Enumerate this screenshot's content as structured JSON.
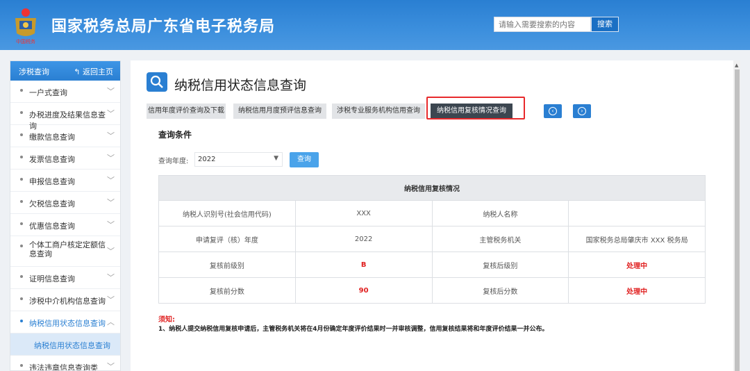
{
  "header": {
    "site_title": "国家税务总局广东省电子税务局",
    "search_placeholder": "请输入需要搜索的内容",
    "search_button": "搜索"
  },
  "sidebar": {
    "title": "涉税查询",
    "back_label": "返回主页",
    "items": [
      {
        "label": "一户式查询"
      },
      {
        "label": "办税进度及结果信息查询"
      },
      {
        "label": "缴款信息查询"
      },
      {
        "label": "发票信息查询"
      },
      {
        "label": "申报信息查询"
      },
      {
        "label": "欠税信息查询"
      },
      {
        "label": "优惠信息查询"
      },
      {
        "label": "个体工商户核定定额信息查询"
      },
      {
        "label": "证明信息查询"
      },
      {
        "label": "涉税中介机构信息查询"
      },
      {
        "label": "纳税信用状态信息查询"
      },
      {
        "label": "违法违章信息查询类"
      }
    ],
    "active_sub": "纳税信用状态信息查询"
  },
  "page": {
    "title": "纳税信用状态信息查询",
    "tabs": [
      "信用年度评价查询及下载",
      "纳税信用月度预评信息查询",
      "涉税专业服务机构信用查询",
      "纳税信用复核情况查询"
    ],
    "active_tab_index": 3
  },
  "query": {
    "section_title": "查询条件",
    "year_label": "查询年度:",
    "year_value": "2022",
    "button": "查询"
  },
  "table": {
    "header": "纳税信用复核情况",
    "rows": [
      [
        "纳税人识别号(社会信用代码)",
        "XXX",
        "纳税人名称",
        ""
      ],
      [
        "申请复评（核）年度",
        "2022",
        "主管税务机关",
        "国家税务总局肇庆市 XXX 税务局"
      ],
      [
        "复核前级别",
        "B",
        "复核后级别",
        "处理中"
      ],
      [
        "复核前分数",
        "90",
        "复核后分数",
        "处理中"
      ]
    ]
  },
  "notice": {
    "title": "须知:",
    "text": "1、纳税人提交纳税信用复核申请后，主管税务机关将在4月份确定年度评价结果时一并审核调整，信用复核结果将和年度评价结果一并公布。"
  },
  "colors": {
    "accent": "#2a7fd2",
    "highlight": "#e8292b",
    "alert": "#e02020"
  }
}
